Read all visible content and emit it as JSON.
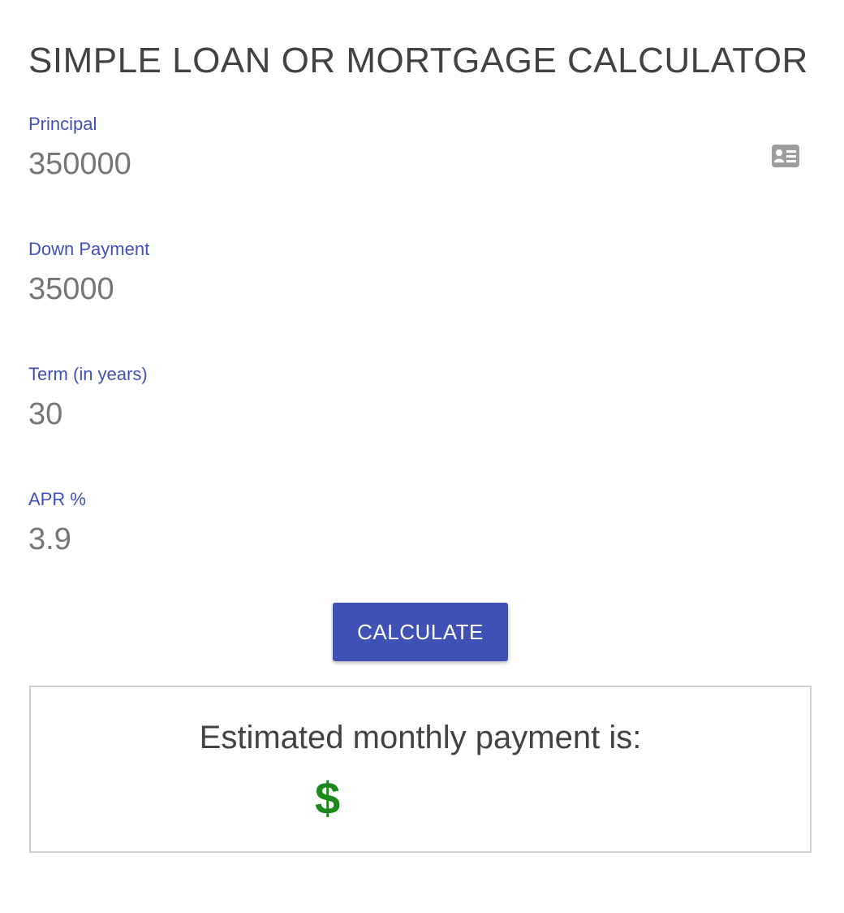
{
  "page": {
    "title": "SIMPLE LOAN OR MORTGAGE CALCULATOR"
  },
  "fields": {
    "principal": {
      "label": "Principal",
      "value": "350000",
      "icon": "contact-card-icon"
    },
    "down_payment": {
      "label": "Down Payment",
      "value": "35000"
    },
    "term": {
      "label": "Term (in years)",
      "value": "30"
    },
    "apr": {
      "label": "APR %",
      "value": "3.9"
    }
  },
  "actions": {
    "calculate_label": "CALCULATE"
  },
  "result": {
    "heading": "Estimated monthly payment is:",
    "currency_symbol": "$",
    "amount": ""
  },
  "colors": {
    "accent": "#3f51b5",
    "currency": "#1b8a1b",
    "title": "#424242",
    "input_text": "#757575"
  }
}
